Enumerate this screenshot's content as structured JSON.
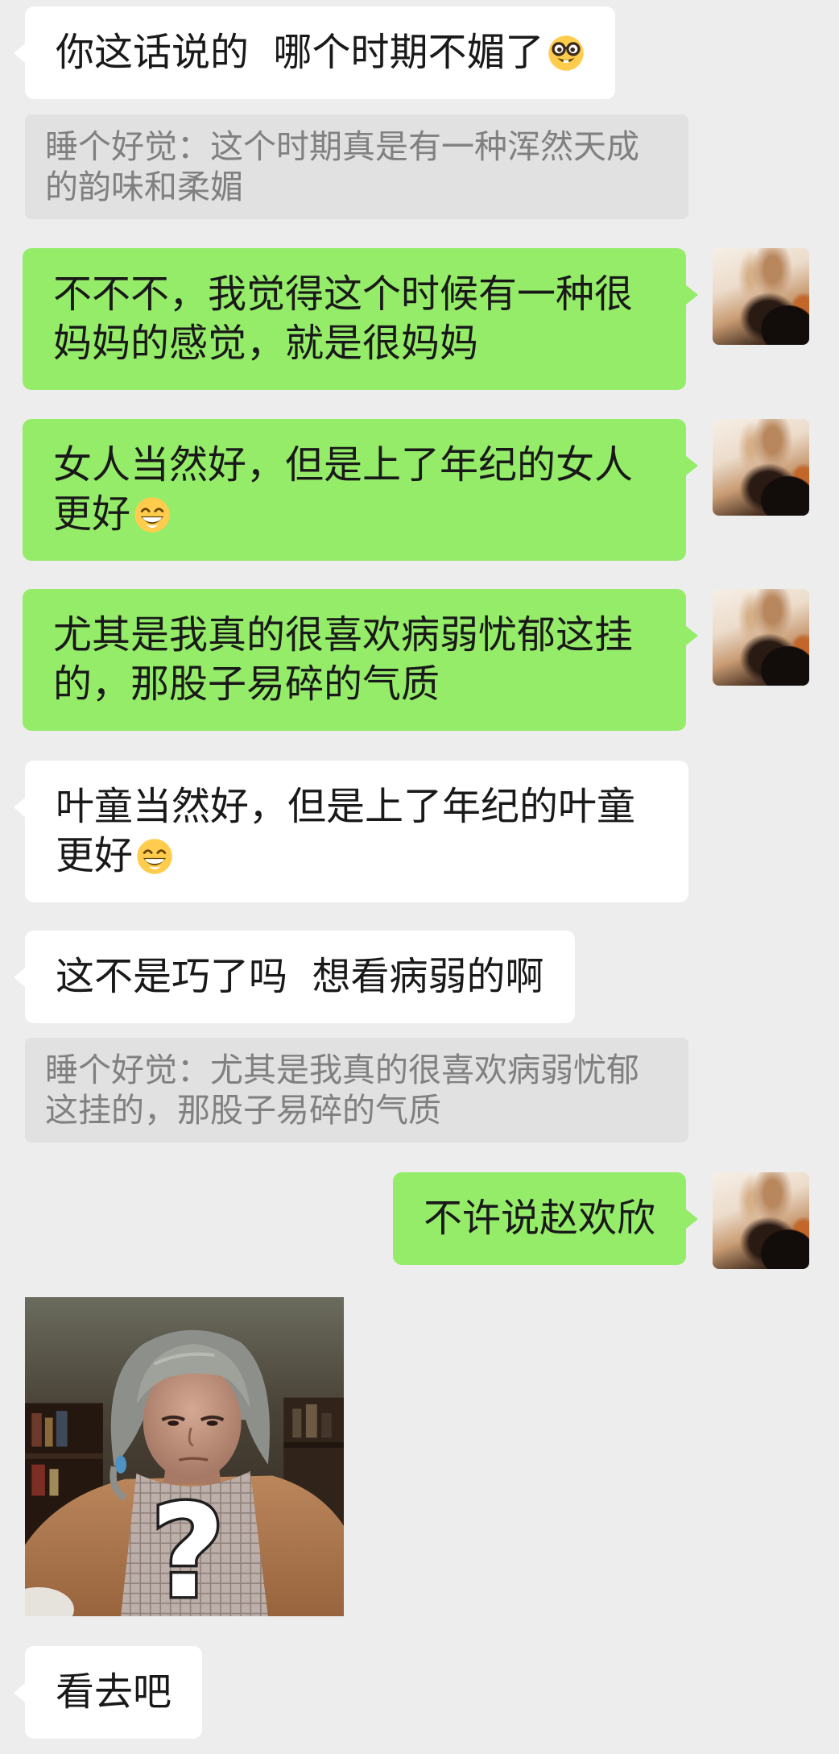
{
  "colors": {
    "background": "#ededed",
    "bubble_self": "#95ec69",
    "bubble_other": "#ffffff",
    "quote_bg": "#e1e1e1",
    "quote_text": "#808080"
  },
  "messages": [
    {
      "from": "other",
      "type": "text",
      "lines": [
        "你这话说的  哪个时期不媚了"
      ],
      "emoji": "nerd-face"
    },
    {
      "type": "quote",
      "lines": [
        "睡个好觉：这个时期真是有一种浑然天成",
        "的韵味和柔媚"
      ]
    },
    {
      "from": "self",
      "type": "text",
      "lines": [
        "不不不，我觉得这个时候有一种很",
        "妈妈的感觉，就是很妈妈"
      ]
    },
    {
      "from": "self",
      "type": "text",
      "lines": [
        "女人当然好，但是上了年纪的女人",
        "更好"
      ],
      "emoji": "grinning-face-with-smiling-eyes"
    },
    {
      "from": "self",
      "type": "text",
      "lines": [
        "尤其是我真的很喜欢病弱忧郁这挂",
        "的，那股子易碎的气质"
      ]
    },
    {
      "from": "other",
      "type": "text",
      "lines": [
        "叶童当然好，但是上了年纪的叶童",
        "更好"
      ],
      "emoji": "grinning-face-with-smiling-eyes"
    },
    {
      "from": "other",
      "type": "text",
      "lines": [
        "这不是巧了吗  想看病弱的啊"
      ]
    },
    {
      "type": "quote",
      "lines": [
        "睡个好觉：尤其是我真的很喜欢病弱忧郁",
        "这挂的，那股子易碎的气质"
      ]
    },
    {
      "from": "self",
      "type": "text",
      "lines": [
        "不许说赵欢欣"
      ]
    },
    {
      "from": "other",
      "type": "image",
      "overlay_text": "?"
    },
    {
      "from": "other",
      "type": "text",
      "lines": [
        "看去吧"
      ]
    }
  ]
}
